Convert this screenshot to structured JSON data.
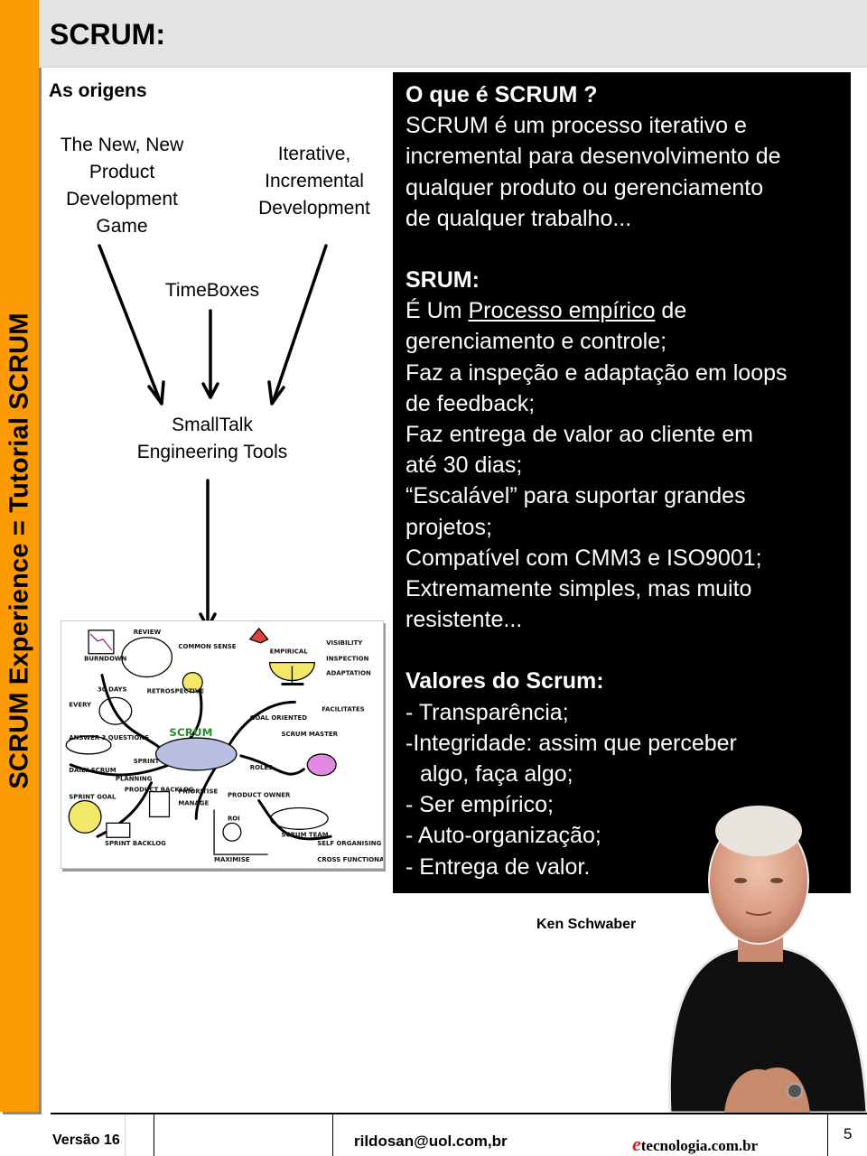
{
  "sidebar": {
    "vertical_title": "SCRUM Experience = Tutorial SCRUM",
    "accent_color": "#fc9a04"
  },
  "header": {
    "title": "SCRUM:"
  },
  "origins": {
    "heading": "As origens",
    "sources": [
      "The New, New Product Development Game",
      "Iterative, Incremental Development",
      "TimeBoxes"
    ],
    "source_lines": {
      "new_product": [
        "The New, New",
        "Product",
        "Development",
        "Game"
      ],
      "iterative": [
        "Iterative,",
        "Incremental",
        "Development"
      ],
      "timeboxes": [
        "TimeBoxes"
      ]
    },
    "merge_lines": [
      "SmallTalk",
      "Engineering Tools"
    ]
  },
  "sketch": {
    "description": "Hand-drawn SCRUM mind map",
    "labels": [
      "BURNDOWN",
      "REVIEW",
      "COMMON SENSE",
      "EMPIRICAL",
      "VISIBILITY",
      "INSPECTION",
      "ADAPTATION",
      "30 DAYS",
      "EVERY",
      "RETROSPECTIVE",
      "GOAL ORIENTED",
      "FACILITATES",
      "ANSWER 3 QUESTIONS",
      "SCRUM",
      "SPRINT",
      "SCRUM MASTER",
      "DAILY SCRUM",
      "ROLES",
      "PRODUCT BACKLOG",
      "PRIORITISE",
      "MANAGE",
      "PRODUCT OWNER",
      "SPRINT GOAL",
      "PLANNING",
      "SPRINT BACKLOG",
      "ROI",
      "MAXIMISE",
      "SCRUM TEAM",
      "SELF ORGANISING",
      "CROSS FUNCTIONAL"
    ]
  },
  "info": {
    "what_heading": "O que é SCRUM ?",
    "what_lines": [
      "SCRUM é um processo iterativo e",
      "incremental para desenvolvimento de",
      "qualquer produto ou gerenciamento",
      "de qualquer trabalho..."
    ],
    "srum_heading": "SRUM:",
    "srum_first_prefix": "É Um ",
    "srum_first_link": "Processo empírico",
    "srum_first_suffix": " de",
    "srum_lines": [
      "gerenciamento e controle;",
      "Faz a inspeção e adaptação em loops",
      "de feedback;",
      "Faz entrega de valor ao cliente em",
      "até 30 dias;",
      "“Escalável” para suportar grandes",
      "projetos;",
      "Compatível com CMM3 e ISO9001;",
      "Extremamente simples, mas muito",
      "resistente..."
    ],
    "values_heading": "Valores do Scrum:",
    "values_lines": [
      "- Transparência;",
      "-Integridade: assim que perceber",
      "algo, faça algo;",
      "- Ser empírico;",
      "- Auto-organização;",
      "- Entrega de valor."
    ]
  },
  "photo": {
    "caption": "Ken Schwaber"
  },
  "footer": {
    "version": "Versão 16",
    "email": "rildosan@uol.com,br",
    "brand_e": "e",
    "brand_rest": "tecnologia.com.br",
    "page_number": "5"
  }
}
